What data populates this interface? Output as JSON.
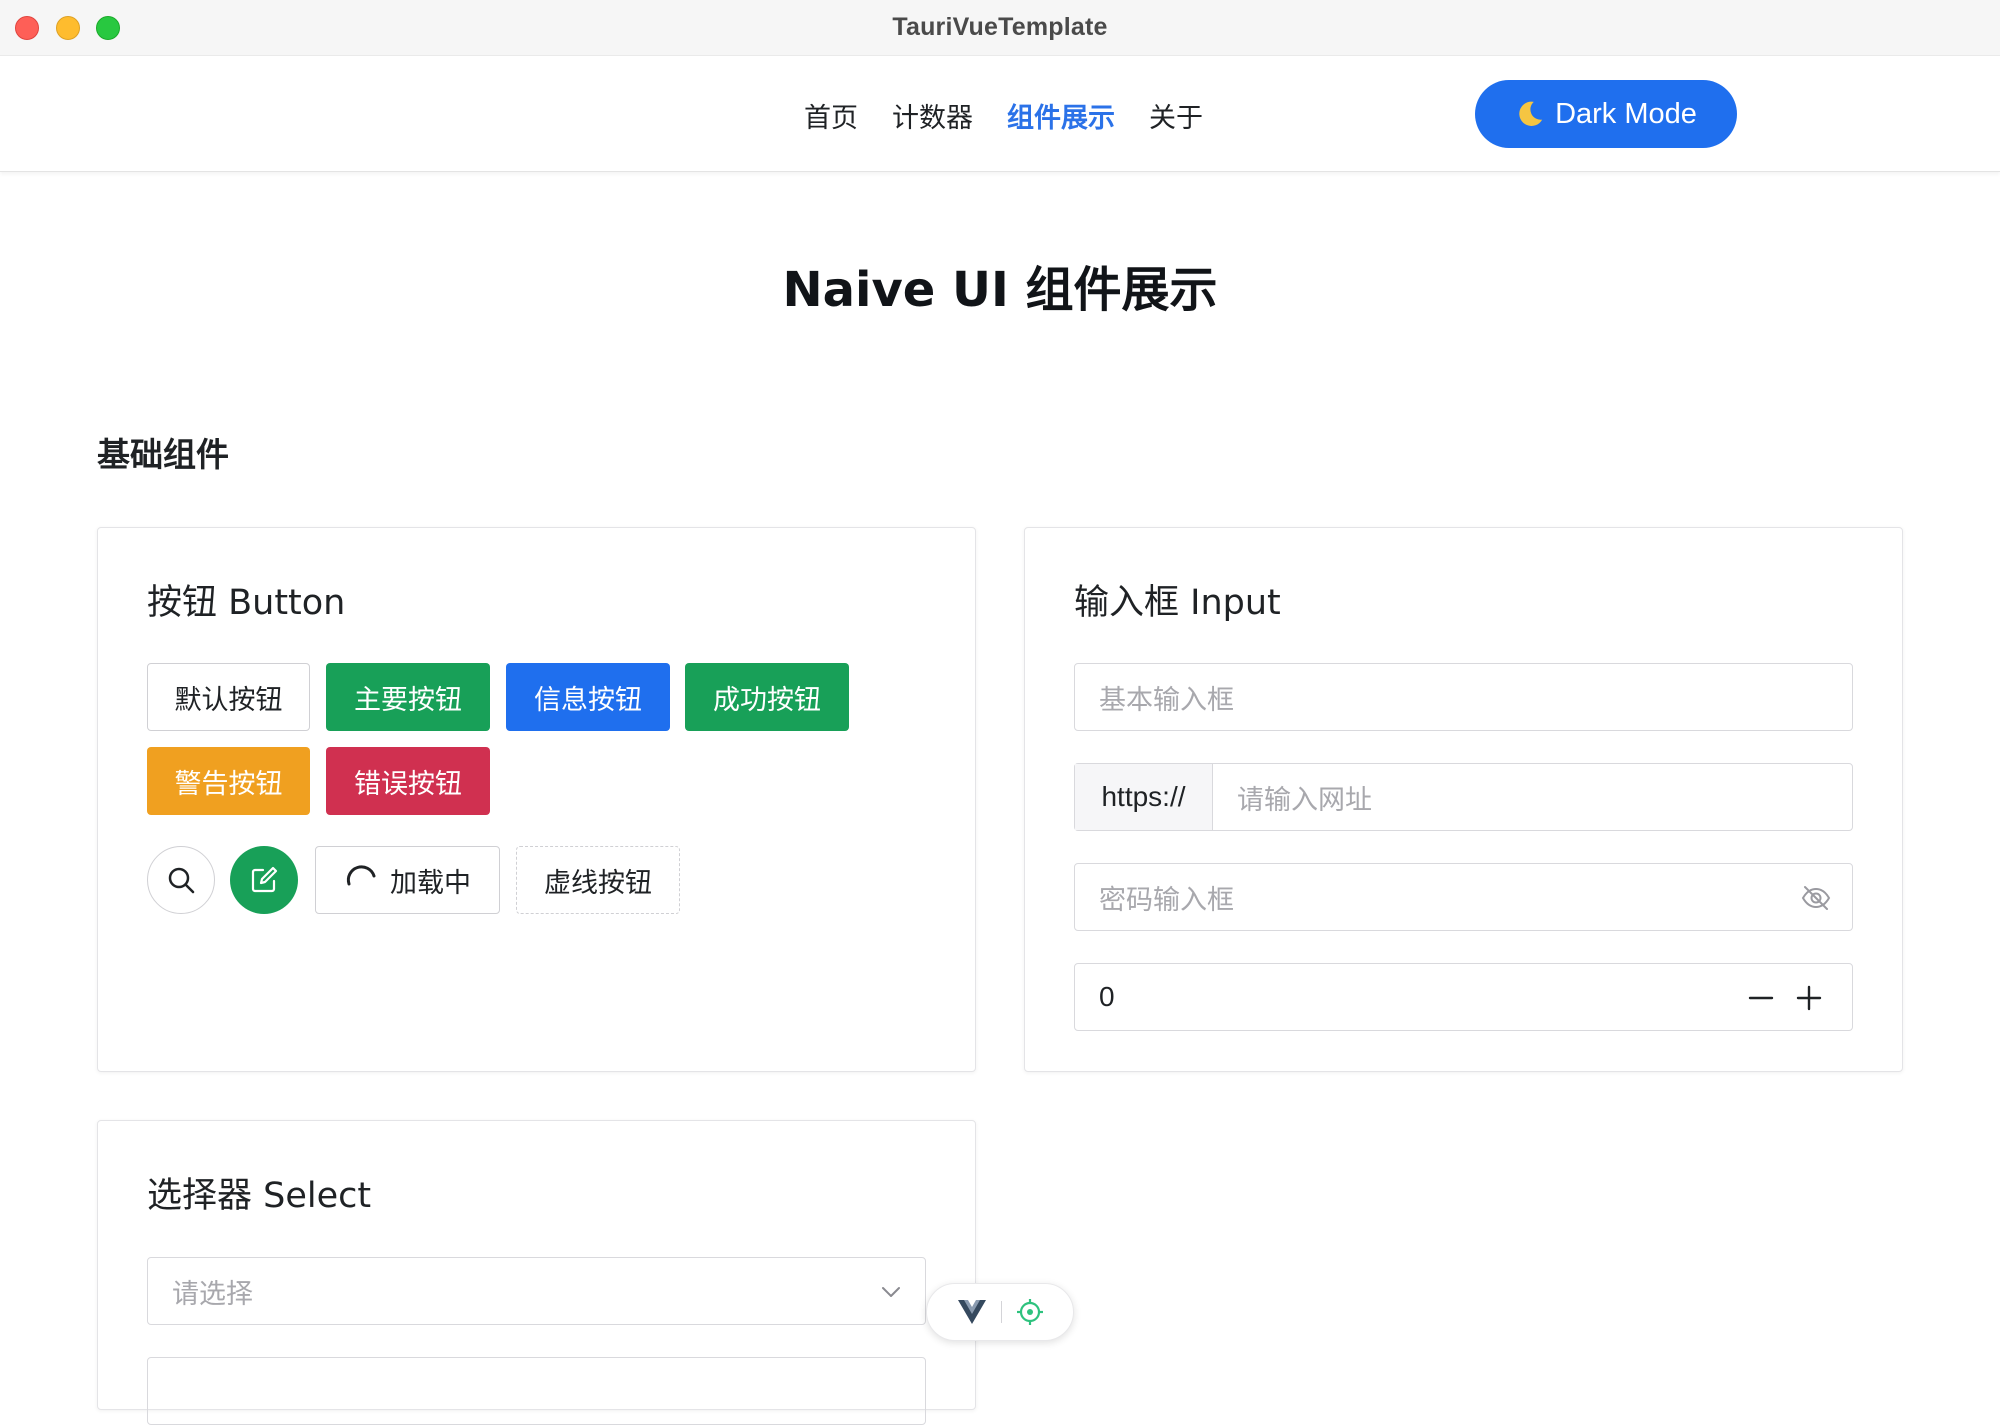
{
  "window": {
    "title": "TauriVueTemplate"
  },
  "nav": {
    "links": [
      "首页",
      "计数器",
      "组件展示",
      "关于"
    ],
    "active_index": 2,
    "dark_mode_label": "Dark Mode"
  },
  "page": {
    "title": "Naive UI 组件展示",
    "section_basic": "基础组件"
  },
  "button_card": {
    "title": "按钮 Button",
    "default_label": "默认按钮",
    "primary_label": "主要按钮",
    "info_label": "信息按钮",
    "success_label": "成功按钮",
    "warning_label": "警告按钮",
    "error_label": "错误按钮",
    "loading_label": "加载中",
    "dashed_label": "虚线按钮"
  },
  "input_card": {
    "title": "输入框 Input",
    "basic_placeholder": "基本输入框",
    "url_prefix": "https://",
    "url_placeholder": "请输入网址",
    "password_placeholder": "密码输入框",
    "number_value": "0"
  },
  "select_card": {
    "title": "选择器 Select",
    "placeholder": "请选择"
  },
  "colors": {
    "primary": "#18a058",
    "info": "#1f6fee",
    "warning": "#f0a020",
    "error": "#d03050",
    "nav_active": "#2b72e8"
  },
  "icons": {
    "dark_mode": "moon-icon",
    "search": "search-icon",
    "edit": "edit-icon",
    "loading": "spinner-icon",
    "password_toggle": "eye-off-icon",
    "number_decrement": "minus-icon",
    "number_increment": "plus-icon",
    "select": "chevron-down-icon",
    "devtools_vue": "vue-logo-icon",
    "devtools_inspect": "crosshair-icon"
  }
}
